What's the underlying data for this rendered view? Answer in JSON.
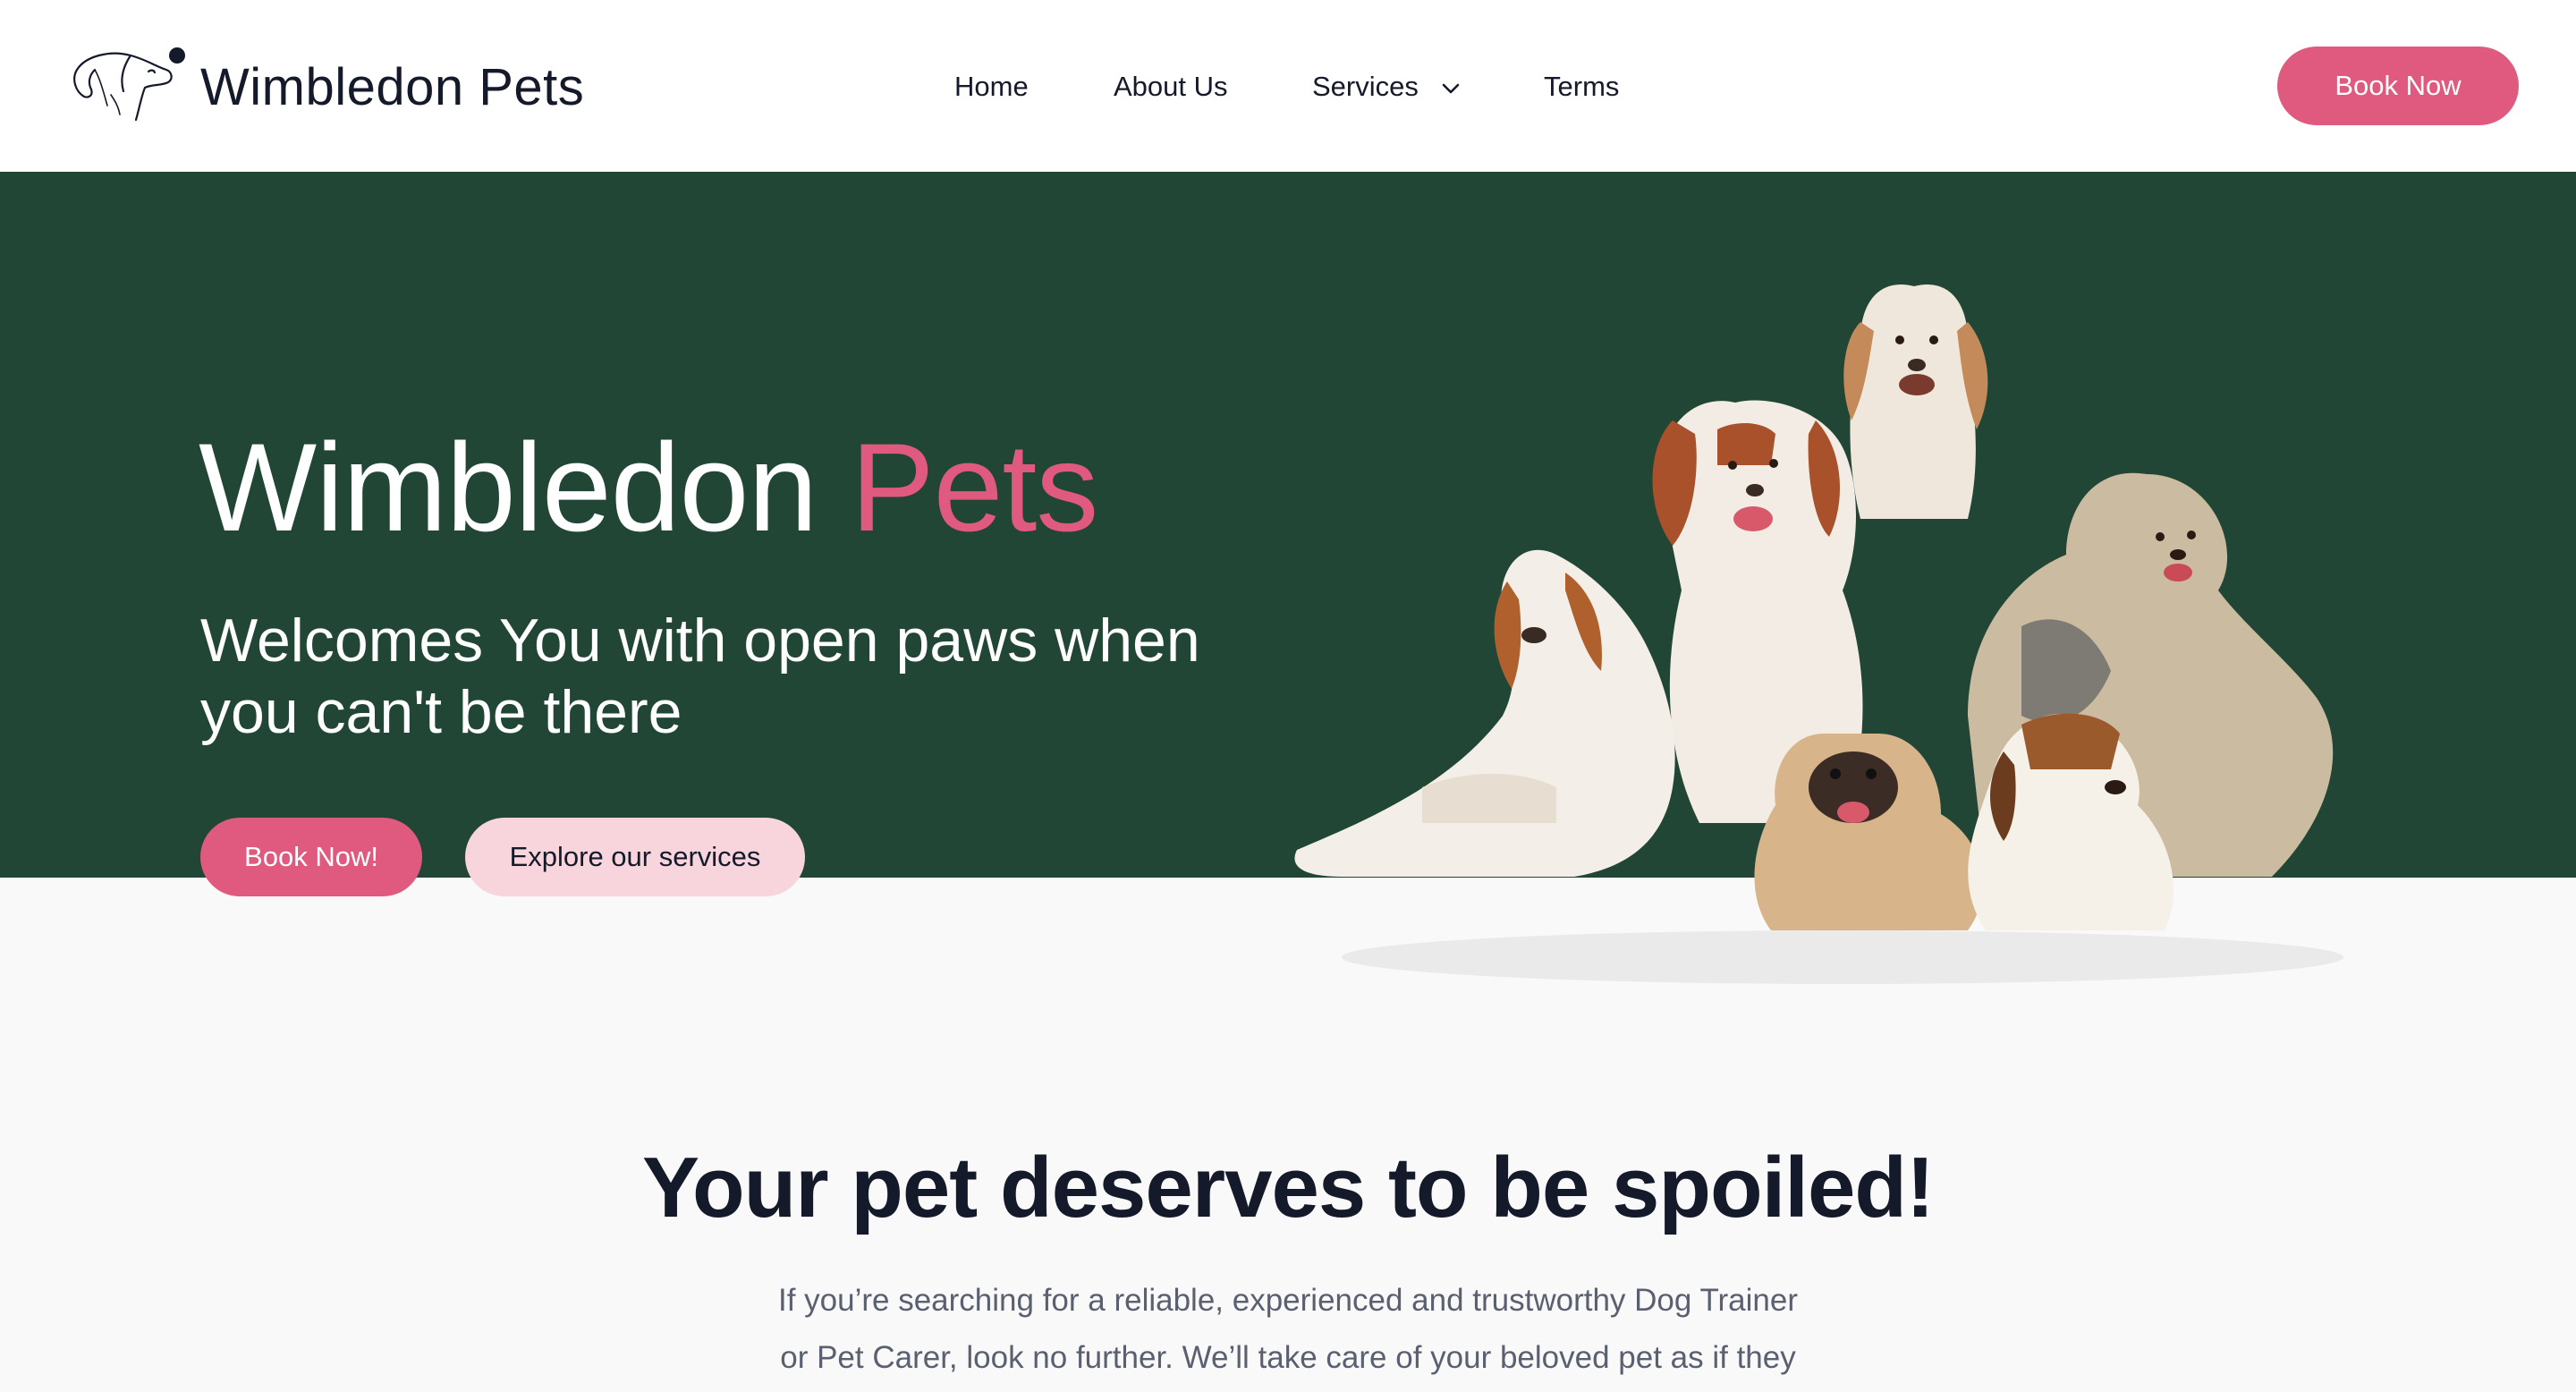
{
  "header": {
    "brand": "Wimbledon Pets",
    "nav": [
      {
        "label": "Home"
      },
      {
        "label": "About Us"
      },
      {
        "label": "Services"
      },
      {
        "label": "Terms"
      }
    ],
    "book_button": "Book Now",
    "services_icon": "chevron-down-icon",
    "logo_icon": "dog-head-logo-icon"
  },
  "hero": {
    "title_main": "Wimbledon",
    "title_accent": "Pets",
    "subtitle": "Welcomes You with open paws when you can't be there",
    "book_button": "Book Now!",
    "explore_button": "Explore our services",
    "image": "group-of-dogs-photo"
  },
  "intro": {
    "heading": "Your pet deserves to be spoiled!",
    "text": "If you’re searching for a reliable, experienced and trustworthy Dog Trainer or Pet Carer, look no further. We’ll take care of your beloved pet as if they"
  },
  "colors": {
    "accent": "#df5a7e",
    "accent_light": "#f8d5dc",
    "hero_bg": "#214635",
    "text_dark": "#141a2a"
  }
}
